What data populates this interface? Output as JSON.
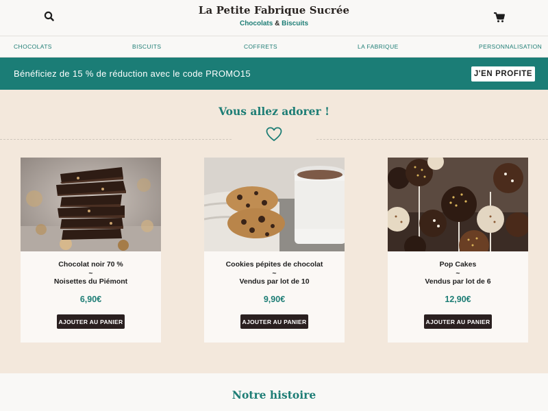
{
  "header": {
    "title": "La Petite Fabrique Sucrée",
    "subtitle_part1": "Chocolats",
    "subtitle_amp": "&",
    "subtitle_part2": "Biscuits",
    "search_icon": "search-icon",
    "cart_icon": "cart-icon"
  },
  "nav": {
    "items": [
      "CHOCOLATS",
      "BISCUITS",
      "COFFRETS",
      "LA FABRIQUE",
      "PERSONNALISATION"
    ]
  },
  "promo": {
    "text": "Bénéficiez de 15 % de réduction avec le code PROMO15",
    "button_label": "J'EN PROFITE",
    "background": "#1b7d76"
  },
  "section": {
    "title": "Vous allez adorer !",
    "icon": "heart-icon"
  },
  "products": [
    {
      "line1": "Chocolat noir 70 %",
      "separator": "~",
      "line2": "Noisettes du Piémont",
      "price": "6,90€",
      "button_label": "AJOUTER AU PANIER",
      "image": "dark-chocolate-stack-image"
    },
    {
      "line1": "Cookies pépites de chocolat",
      "separator": "~",
      "line2": "Vendus par lot de 10",
      "price": "9,90€",
      "button_label": "AJOUTER AU PANIER",
      "image": "cookies-and-hot-chocolate-image"
    },
    {
      "line1": "Pop Cakes",
      "separator": "~",
      "line2": "Vendus par lot de 6",
      "price": "12,90€",
      "button_label": "AJOUTER AU PANIER",
      "image": "pop-cakes-image"
    }
  ],
  "story": {
    "title": "Notre histoire"
  },
  "colors": {
    "accent": "#1d7d75",
    "section_bg": "#f3e8dc",
    "button_dark": "#2a2020"
  }
}
